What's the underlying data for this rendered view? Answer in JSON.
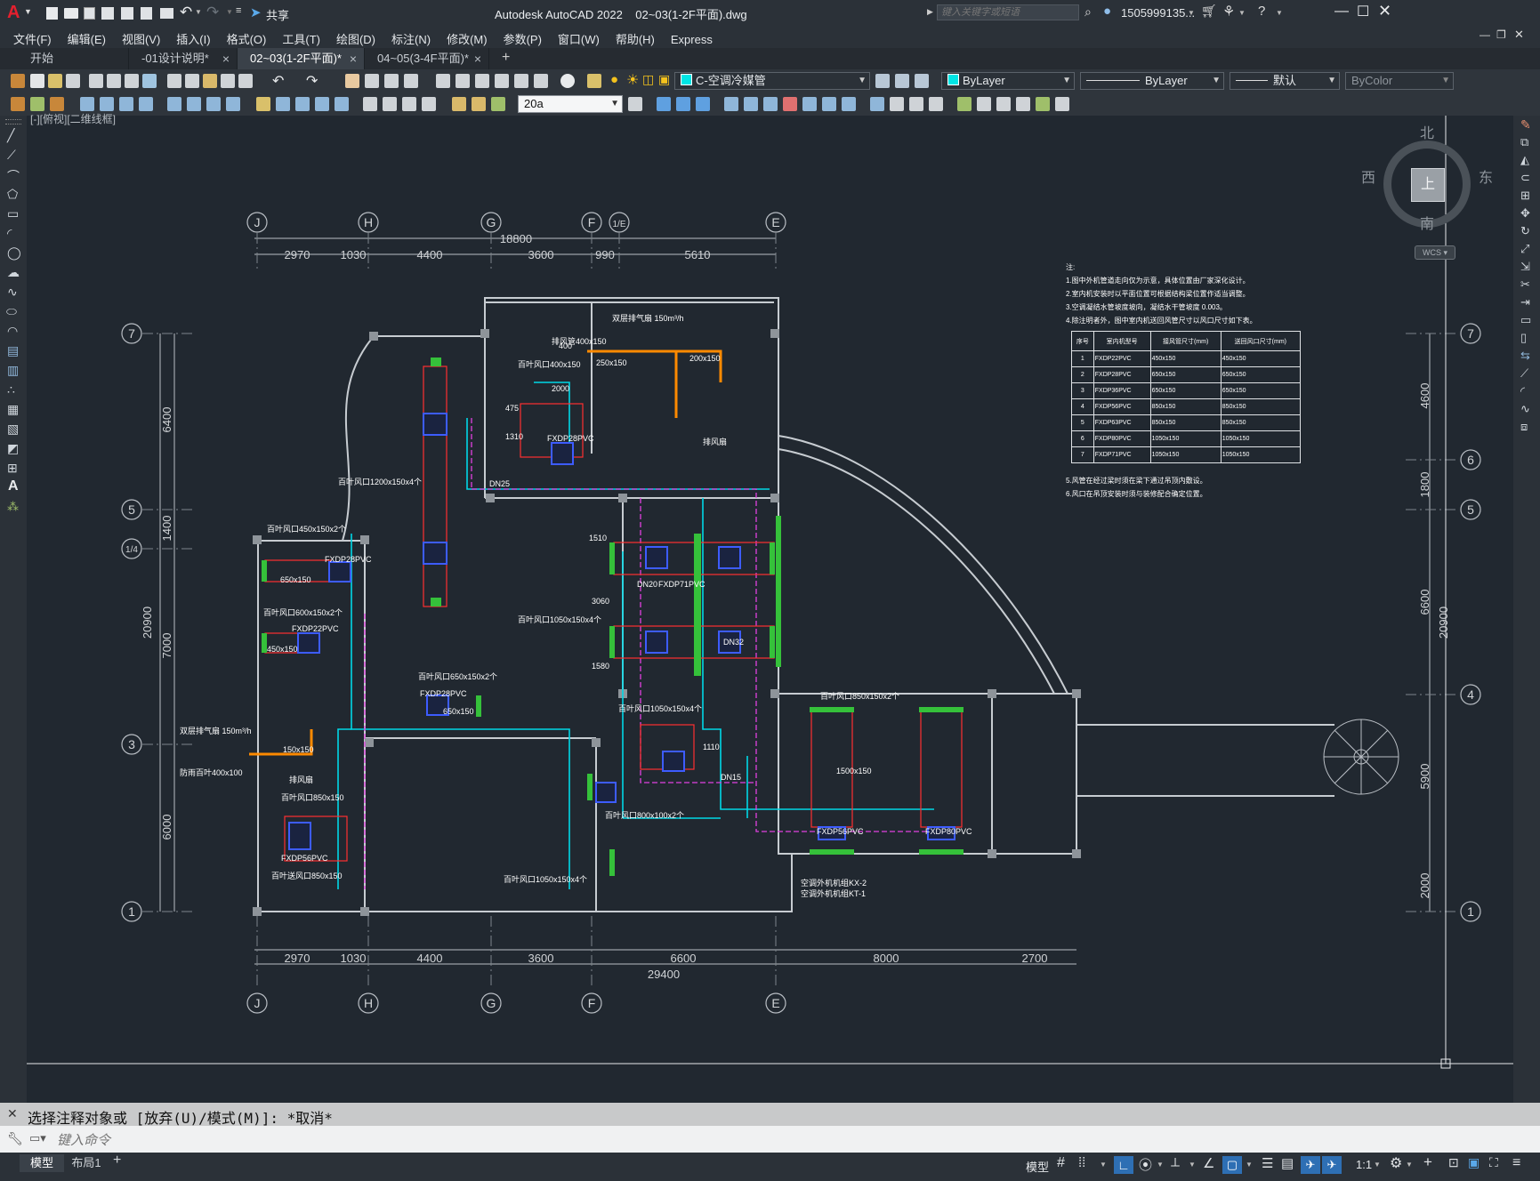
{
  "title": {
    "app_name": "Autodesk AutoCAD 2022",
    "file_name": "02~03(1-2F平面).dwg",
    "share_label": "共享",
    "search_placeholder": "键入关键字或短语",
    "user_name": "1505999135...",
    "app_logo": "A"
  },
  "menu": [
    "文件(F)",
    "编辑(E)",
    "视图(V)",
    "插入(I)",
    "格式(O)",
    "工具(T)",
    "绘图(D)",
    "标注(N)",
    "修改(M)",
    "参数(P)",
    "窗口(W)",
    "帮助(H)",
    "Express"
  ],
  "tabs": [
    {
      "label": "开始",
      "closable": false
    },
    {
      "label": "-01设计说明*",
      "closable": true
    },
    {
      "label": "02~03(1-2F平面)*",
      "closable": true,
      "active": true
    },
    {
      "label": "04~05(3-4F平面)*",
      "closable": true
    }
  ],
  "toolbar": {
    "layer_name": "C-空调冷媒管",
    "color": "ByLayer",
    "linetype": "ByLayer",
    "lineweight": "默认",
    "plotstyle": "ByColor",
    "text_style": "20a"
  },
  "viewport": {
    "label": "[-][俯视][二维线框]",
    "compass": {
      "north": "北",
      "south": "南",
      "east": "东",
      "west": "西",
      "top": "上",
      "wcs": "WCS"
    }
  },
  "drawing": {
    "grid_letters_top": [
      "J",
      "H",
      "G",
      "F",
      "1/E",
      "E"
    ],
    "grid_letters_bottom": [
      "J",
      "H",
      "G",
      "F",
      "E"
    ],
    "grid_numbers_left": [
      "7",
      "5",
      "1/4",
      "3",
      "1"
    ],
    "grid_numbers_right": [
      "7",
      "6",
      "5",
      "4",
      "1"
    ],
    "dim_top_total": "18800",
    "dims_top": [
      "2970",
      "1030",
      "4400",
      "3600",
      "990",
      "5610"
    ],
    "dims_bottom": [
      "2970",
      "1030",
      "4400",
      "3600",
      "6600",
      "8000",
      "2700"
    ],
    "dim_bottom_total": "29400",
    "dims_left": [
      "6400",
      "1400",
      "7000",
      "6000"
    ],
    "dim_left_total": "20900",
    "dims_right": [
      "4600",
      "1800",
      "6600",
      "5900",
      "2000"
    ],
    "dim_right_total": "20900",
    "notes_title": "注:",
    "notes": [
      "1.图中外机管道走向仅为示意，具体位置由厂家深化设计。",
      "2.室内机安装时以平面位置可根据结构梁位置作适当调整。",
      "3.空调凝结水管坡度坡向，凝结水干管坡度 0.003。",
      "4.除注明者外，图中室内机送回风管尺寸以风口尺寸如下表。"
    ],
    "notes_after": [
      "5.风管在经过梁时须在梁下通过吊顶内敷设。",
      "6.风口在吊顶安装时须与装修配合确定位置。"
    ],
    "table": {
      "headers": [
        "序号",
        "室内机型号",
        "接风管尺寸(mm)",
        "送回风口尺寸(mm)"
      ],
      "rows": [
        [
          "1",
          "FXDP22PVC",
          "450x150",
          "450x150"
        ],
        [
          "2",
          "FXDP28PVC",
          "650x150",
          "650x150"
        ],
        [
          "3",
          "FXDP36PVC",
          "650x150",
          "650x150"
        ],
        [
          "4",
          "FXDP56PVC",
          "850x150",
          "850x150"
        ],
        [
          "5",
          "FXDP63PVC",
          "850x150",
          "850x150"
        ],
        [
          "6",
          "FXDP80PVC",
          "1050x150",
          "1050x150"
        ],
        [
          "7",
          "FXDP71PVC",
          "1050x150",
          "1050x150"
        ]
      ]
    },
    "labels": [
      "排风管400x150",
      "百叶风口400x150",
      "双层排气扇 150m³/h",
      "200x150",
      "250x150",
      "排风扇",
      "FXDP28PVC",
      "百叶风口1200x150x4个",
      "百叶风口450x150x2个",
      "FXDP28PVC",
      "650x150",
      "百叶风口600x150x2个",
      "FXDP22PVC",
      "450x150",
      "百叶风口650x150x2个",
      "FXDP28PVC",
      "650x150",
      "双层排气扇 150m³/h",
      "防雨百叶400x100",
      "150x150",
      "排风扇",
      "百叶风口850x150",
      "FXDP56PVC",
      "百叶送风口850x150",
      "百叶风口1050x150x4个",
      "FXDP71PVC",
      "百叶风口1050x150x4个",
      "百叶风口850x150x2个",
      "FXDP56PVC",
      "百叶风口1050x150x4个",
      "FXDP80PVC",
      "空调外机机组KX-2",
      "空调外机机组KT-1",
      "百叶风口800x100x2个",
      "1500x150",
      "DN25",
      "DN20",
      "DN32",
      "DN15",
      "2000",
      "1110",
      "1510",
      "3060",
      "1580",
      "1310",
      "475",
      "400"
    ]
  },
  "command": {
    "history": "选择注释对象或 [放弃(U)/模式(M)]: *取消*",
    "placeholder": "键入命令"
  },
  "status": {
    "layout_tabs": [
      "模型",
      "布局1"
    ],
    "model_label": "模型",
    "scale": "1:1"
  }
}
